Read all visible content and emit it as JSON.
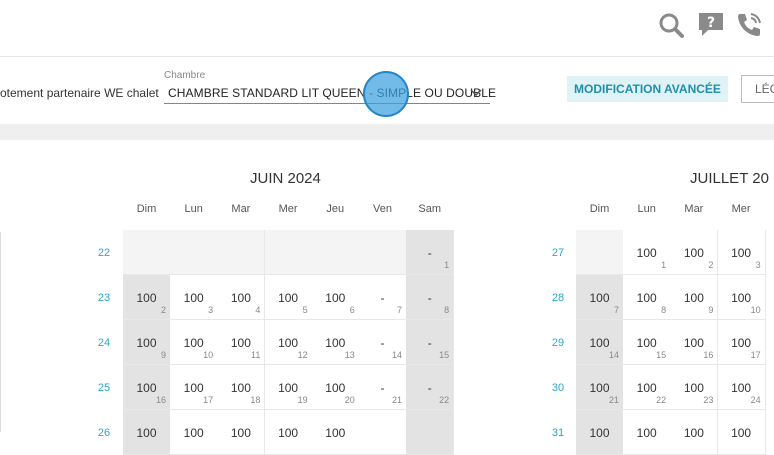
{
  "toolbar": {
    "accommodation_text": "otement partenaire WE chalet",
    "room_label": "Chambre",
    "room_value": "CHAMBRE STANDARD LIT QUEEN - SIMPLE OU DOUBLE",
    "advanced_button": "MODIFICATION AVANCÉE",
    "legend_button": "LÉG"
  },
  "icons": [
    "search-icon",
    "help-icon",
    "phone-icon",
    "chevron-down-icon"
  ],
  "colors": {
    "accent": "#2aa7c4",
    "weekend_cell": "#e3e3e3",
    "button_bg": "#dff3f7",
    "touch": "#3ba0de"
  },
  "calendars": [
    {
      "title": "JUIN 2024",
      "weekdays": [
        "Dim",
        "Lun",
        "Mar",
        "Mer",
        "Jeu",
        "Ven",
        "Sam"
      ],
      "weeks": [
        {
          "num": "22",
          "days": [
            {
              "empty": true
            },
            {
              "empty": true
            },
            {
              "empty": true
            },
            {
              "empty": true
            },
            {
              "empty": true
            },
            {
              "empty": true
            },
            {
              "price": "-",
              "day": "1"
            }
          ]
        },
        {
          "num": "23",
          "days": [
            {
              "price": "100",
              "day": "2"
            },
            {
              "price": "100",
              "day": "3"
            },
            {
              "price": "100",
              "day": "4"
            },
            {
              "price": "100",
              "day": "5"
            },
            {
              "price": "100",
              "day": "6"
            },
            {
              "price": "-",
              "day": "7"
            },
            {
              "price": "-",
              "day": "8"
            }
          ]
        },
        {
          "num": "24",
          "days": [
            {
              "price": "100",
              "day": "9"
            },
            {
              "price": "100",
              "day": "10"
            },
            {
              "price": "100",
              "day": "11"
            },
            {
              "price": "100",
              "day": "12"
            },
            {
              "price": "100",
              "day": "13"
            },
            {
              "price": "-",
              "day": "14"
            },
            {
              "price": "-",
              "day": "15"
            }
          ]
        },
        {
          "num": "25",
          "days": [
            {
              "price": "100",
              "day": "16"
            },
            {
              "price": "100",
              "day": "17"
            },
            {
              "price": "100",
              "day": "18"
            },
            {
              "price": "100",
              "day": "19"
            },
            {
              "price": "100",
              "day": "20"
            },
            {
              "price": "-",
              "day": "21"
            },
            {
              "price": "-",
              "day": "22"
            }
          ]
        },
        {
          "num": "26",
          "days": [
            {
              "price": "100",
              "day": ""
            },
            {
              "price": "100",
              "day": ""
            },
            {
              "price": "100",
              "day": ""
            },
            {
              "price": "100",
              "day": ""
            },
            {
              "price": "100",
              "day": ""
            },
            {
              "price": "",
              "day": ""
            },
            {
              "price": "",
              "day": ""
            }
          ]
        }
      ]
    },
    {
      "title": "JUILLET 20",
      "weekdays": [
        "Dim",
        "Lun",
        "Mar",
        "Mer"
      ],
      "weeks": [
        {
          "num": "27",
          "days": [
            {
              "empty": true
            },
            {
              "price": "100",
              "day": "1"
            },
            {
              "price": "100",
              "day": "2"
            },
            {
              "price": "100",
              "day": "3"
            }
          ]
        },
        {
          "num": "28",
          "days": [
            {
              "price": "100",
              "day": "7"
            },
            {
              "price": "100",
              "day": "8"
            },
            {
              "price": "100",
              "day": "9"
            },
            {
              "price": "100",
              "day": "10"
            }
          ]
        },
        {
          "num": "29",
          "days": [
            {
              "price": "100",
              "day": "14"
            },
            {
              "price": "100",
              "day": "15"
            },
            {
              "price": "100",
              "day": "16"
            },
            {
              "price": "100",
              "day": "17"
            }
          ]
        },
        {
          "num": "30",
          "days": [
            {
              "price": "100",
              "day": "21"
            },
            {
              "price": "100",
              "day": "22"
            },
            {
              "price": "100",
              "day": "23"
            },
            {
              "price": "100",
              "day": "24"
            }
          ]
        },
        {
          "num": "31",
          "days": [
            {
              "price": "100",
              "day": ""
            },
            {
              "price": "100",
              "day": ""
            },
            {
              "price": "100",
              "day": ""
            },
            {
              "price": "100",
              "day": ""
            }
          ]
        }
      ]
    }
  ]
}
